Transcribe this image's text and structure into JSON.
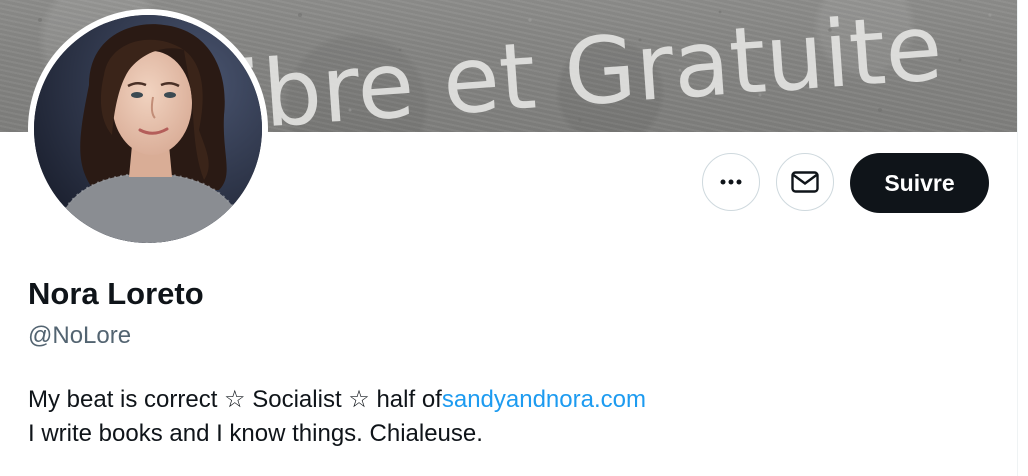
{
  "banner": {
    "graffiti_text": "ibre et Gratuite"
  },
  "profile": {
    "name": "Nora Loreto",
    "handle": "@NoLore"
  },
  "actions": {
    "more_icon": "ellipsis-icon",
    "message_icon": "envelope-icon",
    "follow_label": "Suivre"
  },
  "bio": {
    "line1_text": "My beat is correct ☆ Socialist ☆ half of",
    "line1_link": "sandyandnora.com",
    "line2_text": "I write books and I know things. Chialeuse."
  },
  "colors": {
    "link": "#1d9bf0",
    "follow_bg": "#0f1419",
    "handle": "#536471"
  }
}
